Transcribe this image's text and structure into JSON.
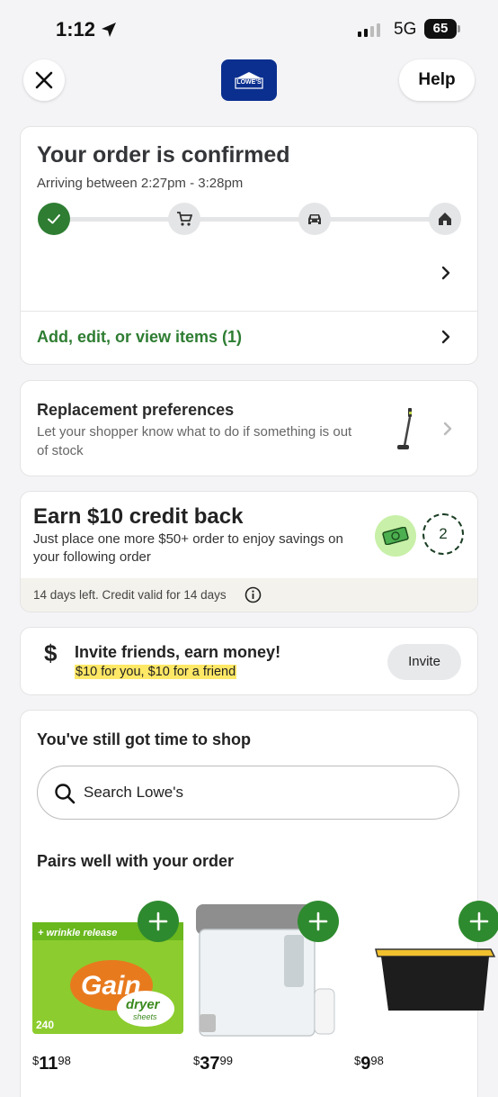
{
  "status_bar": {
    "time": "1:12",
    "network": "5G",
    "battery": "65"
  },
  "header": {
    "logo_text": "LOWE'S",
    "help_label": "Help"
  },
  "order": {
    "title": "Your order is confirmed",
    "arrival": "Arriving between 2:27pm - 3:28pm",
    "items_link": "Add, edit, or view items (1)"
  },
  "replacement": {
    "title": "Replacement preferences",
    "description": "Let your shopper know what to do if something is out of stock"
  },
  "earn": {
    "title": "Earn $10 credit back",
    "description": "Just place one more $50+ order to enjoy savings on your following order",
    "count": "2",
    "footer": "14 days left. Credit valid for 14 days"
  },
  "invite": {
    "icon_text": "$",
    "title": "Invite friends, earn money!",
    "subtitle": "$10 for you, $10 for a friend",
    "button_label": "Invite"
  },
  "shop": {
    "title": "You've still got time to shop",
    "search_placeholder": "Search Lowe's",
    "pairs_title": "Pairs well with your order",
    "products": [
      {
        "name": "Gain dryer sheets",
        "box_banner": "+ wrinkle release",
        "brand": "Gain",
        "product_line": "dryer",
        "product_line_2": "sheets",
        "count": "240",
        "price_dollars": "11",
        "price_cents": "98"
      },
      {
        "name": "Water filter dispenser",
        "price_dollars": "37",
        "price_cents": "99"
      },
      {
        "name": "Storage tote",
        "price_dollars": "9",
        "price_cents": "98"
      }
    ]
  },
  "colors": {
    "accent_green": "#2e7d32",
    "brand_blue": "#0b2f8f",
    "highlight_yellow": "#ffe866"
  }
}
